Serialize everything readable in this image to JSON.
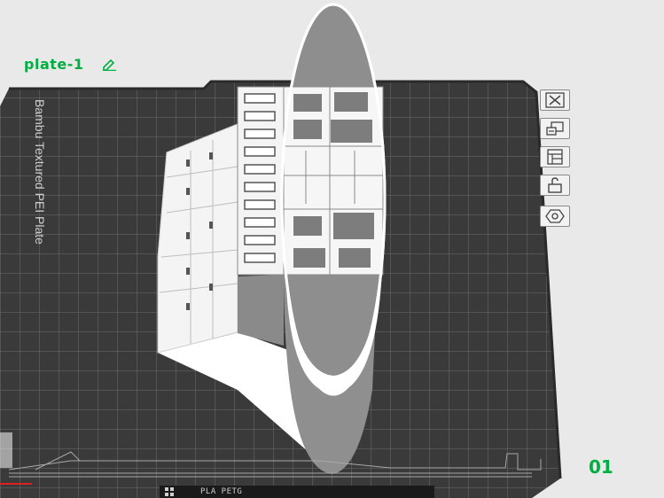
{
  "plate": {
    "name": "plate-1",
    "number": "01",
    "bed_label": "Bambu Textured PEI Plate"
  },
  "toolbar": {
    "items": [
      {
        "name": "remove-plate-button",
        "icon": "close-icon"
      },
      {
        "name": "arrange-button",
        "icon": "arrange-icon"
      },
      {
        "name": "auto-orient-button",
        "icon": "layout-icon"
      },
      {
        "name": "lock-plate-button",
        "icon": "lock-icon"
      },
      {
        "name": "plate-settings-button",
        "icon": "hexagon-icon"
      }
    ]
  },
  "status_bar": {
    "text": "PLA PETG"
  },
  "colors": {
    "accent": "#00ae42",
    "bed": "#3d3d3d",
    "grid": "#6a6a6a",
    "model": "#ffffff",
    "model_shade": "#8e8e8e"
  }
}
